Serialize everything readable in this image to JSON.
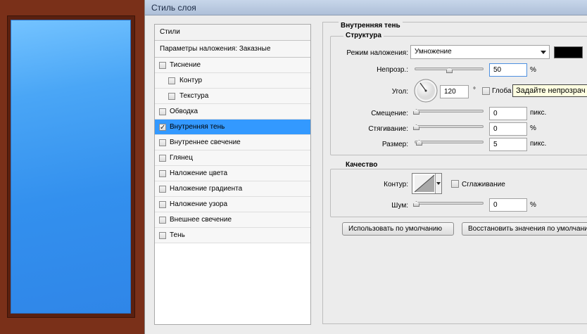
{
  "window": {
    "title": "Стиль слоя"
  },
  "styles_panel": {
    "header": "Стили",
    "blend_options": "Параметры наложения: Заказные",
    "items": [
      {
        "label": "Тиснение",
        "checked": false,
        "indent": false,
        "active": false
      },
      {
        "label": "Контур",
        "checked": false,
        "indent": true,
        "active": false
      },
      {
        "label": "Текстура",
        "checked": false,
        "indent": true,
        "active": false
      },
      {
        "label": "Обводка",
        "checked": false,
        "indent": false,
        "active": false
      },
      {
        "label": "Внутренняя тень",
        "checked": true,
        "indent": false,
        "active": true
      },
      {
        "label": "Внутреннее свечение",
        "checked": false,
        "indent": false,
        "active": false
      },
      {
        "label": "Глянец",
        "checked": false,
        "indent": false,
        "active": false
      },
      {
        "label": "Наложение цвета",
        "checked": false,
        "indent": false,
        "active": false
      },
      {
        "label": "Наложение градиента",
        "checked": false,
        "indent": false,
        "active": false
      },
      {
        "label": "Наложение узора",
        "checked": false,
        "indent": false,
        "active": false
      },
      {
        "label": "Внешнее свечение",
        "checked": false,
        "indent": false,
        "active": false
      },
      {
        "label": "Тень",
        "checked": false,
        "indent": false,
        "active": false
      }
    ]
  },
  "inner_shadow": {
    "title": "Внутренняя тень",
    "structure": {
      "title": "Структура",
      "blend_mode_label": "Режим наложения:",
      "blend_mode_value": "Умножение",
      "shadow_color": "#000000",
      "opacity_label": "Непрозр.:",
      "opacity_value": "50",
      "opacity_unit": "%",
      "opacity_level": 50,
      "angle_label": "Угол:",
      "angle_value": "120",
      "angle_unit": "°",
      "global_light_label": "Глоба",
      "distance_label": "Смещение:",
      "distance_value": "0",
      "distance_unit": "пикс.",
      "choke_label": "Стягивание:",
      "choke_value": "0",
      "choke_unit": "%",
      "size_label": "Размер:",
      "size_value": "5",
      "size_unit": "пикс."
    },
    "quality": {
      "title": "Качество",
      "contour_label": "Контур:",
      "antialias_label": "Сглаживание",
      "noise_label": "Шум:",
      "noise_value": "0",
      "noise_unit": "%"
    },
    "tooltip": "Задайте непрозрач",
    "buttons": {
      "make_default": "Использовать по умолчанию",
      "reset_default": "Восстановить значения по умолчанию"
    }
  },
  "colors": {
    "accent": "#3399ff",
    "frame": "#7a3019",
    "preview_blue": "#3390ee"
  }
}
